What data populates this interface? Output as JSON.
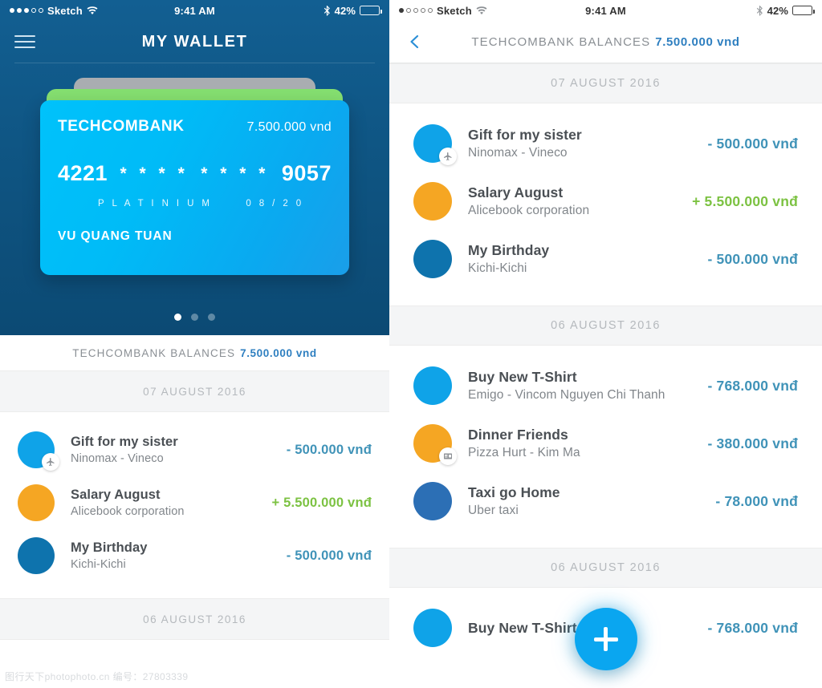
{
  "left_screen": {
    "status_bar": {
      "carrier": "Sketch",
      "time": "9:41 AM",
      "battery_percent": "42%",
      "signal_dots_filled": 3,
      "signal_dots_total": 5,
      "wifi_icon": "wifi-icon",
      "bluetooth_icon": "bluetooth-icon",
      "battery_icon": "battery-icon"
    },
    "nav": {
      "menu_icon": "hamburger-menu-icon",
      "title": "MY WALLET"
    },
    "card": {
      "bank": "TECHCOMBANK",
      "balance": "7.500.000 vnd",
      "number_first": "4221",
      "number_mask_1": "* * * *",
      "number_mask_2": "* * * *",
      "number_last": "9057",
      "tier": "P L A T I N I U M",
      "expiry": "0 8 / 2 0",
      "holder": "VU QUANG TUAN",
      "front_color": "#00baf6",
      "middle_card_color": "#85df70",
      "back_card_color": "#a9adb1"
    },
    "pager": {
      "total": 3,
      "active_index": 0
    },
    "balances": {
      "label": "TECHCOMBANK BALANCES",
      "value": "7.500.000 vnd"
    },
    "sections": [
      {
        "date": "07 AUGUST 2016",
        "transactions": [
          {
            "title": "Gift for my sister",
            "subtitle": "Ninomax - Vineco",
            "amount": "- 500.000 vnđ",
            "sign": "neg",
            "avatar_color": "#0fa3e8",
            "badge_icon": "airplane-icon"
          },
          {
            "title": "Salary August",
            "subtitle": "Alicebook corporation",
            "amount": "+ 5.500.000 vnđ",
            "sign": "pos",
            "avatar_color": "#f5a623",
            "badge_icon": "none"
          },
          {
            "title": "My Birthday",
            "subtitle": "Kichi-Kichi",
            "amount": "- 500.000 vnđ",
            "sign": "neg",
            "avatar_color": "#0e73ad",
            "badge_icon": "none"
          }
        ]
      },
      {
        "date": "06 AUGUST 2016",
        "transactions": []
      }
    ]
  },
  "right_screen": {
    "status_bar": {
      "carrier": "Sketch",
      "time": "9:41 AM",
      "battery_percent": "42%",
      "signal_dots_filled": 1,
      "signal_dots_total": 5,
      "wifi_icon": "wifi-icon",
      "bluetooth_icon": "bluetooth-icon",
      "battery_icon": "battery-icon"
    },
    "nav": {
      "back_icon": "back-chevron-icon",
      "label": "TECHCOMBANK BALANCES",
      "value": "7.500.000 vnd"
    },
    "sections": [
      {
        "date": "07 AUGUST 2016",
        "transactions": [
          {
            "title": "Gift for my sister",
            "subtitle": "Ninomax - Vineco",
            "amount": "- 500.000 vnđ",
            "sign": "neg",
            "avatar_color": "#0fa3e8",
            "badge_icon": "airplane-icon"
          },
          {
            "title": "Salary August",
            "subtitle": "Alicebook corporation",
            "amount": "+ 5.500.000 vnđ",
            "sign": "pos",
            "avatar_color": "#f5a623",
            "badge_icon": "none"
          },
          {
            "title": "My Birthday",
            "subtitle": "Kichi-Kichi",
            "amount": "- 500.000 vnđ",
            "sign": "neg",
            "avatar_color": "#0e73ad",
            "badge_icon": "none"
          }
        ]
      },
      {
        "date": "06 AUGUST 2016",
        "transactions": [
          {
            "title": "Buy New T-Shirt",
            "subtitle": "Emigo - Vincom Nguyen Chi Thanh",
            "amount": "- 768.000 vnđ",
            "sign": "neg",
            "avatar_color": "#0fa3e8",
            "badge_icon": "none"
          },
          {
            "title": "Dinner Friends",
            "subtitle": "Pizza Hurt - Kim Ma",
            "amount": "- 380.000 vnđ",
            "sign": "neg",
            "avatar_color": "#f5a623",
            "badge_icon": "card-icon"
          },
          {
            "title": "Taxi go Home",
            "subtitle": "Uber taxi",
            "amount": "- 78.000 vnđ",
            "sign": "neg",
            "avatar_color": "#2c6fb5",
            "badge_icon": "none"
          }
        ]
      },
      {
        "date": "06 AUGUST 2016",
        "transactions": [
          {
            "title": "Buy New T-Shirt",
            "subtitle": "",
            "amount": "- 768.000 vnđ",
            "sign": "neg",
            "avatar_color": "#0fa3e8",
            "badge_icon": "none"
          }
        ]
      }
    ],
    "fab": {
      "icon": "plus-icon",
      "color": "#0aa6f0"
    }
  },
  "watermark": "图行天下photophoto.cn  编号：27803339",
  "colors": {
    "header_blue": "#115b8c",
    "header_blue_dark": "#0c4a74",
    "accent_blue": "#2e7fc0",
    "amount_negative": "#4093b8",
    "amount_positive": "#7cc242",
    "date_header_bg": "#f4f5f6"
  }
}
